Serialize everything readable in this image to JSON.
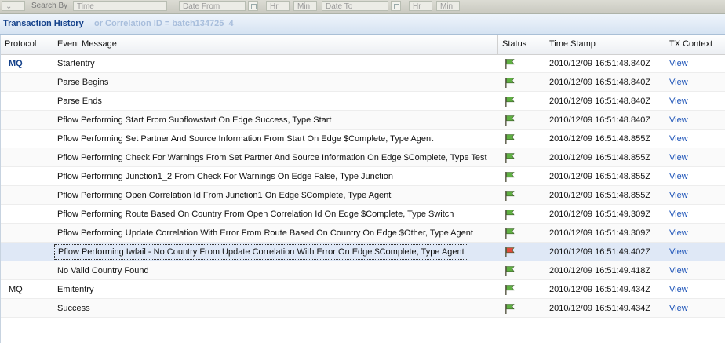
{
  "toolbar": {
    "search_by_label": "Search By",
    "search_by_value": "Time",
    "date_from_placeholder": "Date From",
    "hr1": "Hr",
    "min1": "Min",
    "date_to_placeholder": "Date To",
    "hr2": "Hr",
    "min2": "Min"
  },
  "panel": {
    "title": "Transaction History",
    "subtitle_ghost": "or Correlation ID = batch134725_4"
  },
  "columns": {
    "protocol": "Protocol",
    "message": "Event Message",
    "status": "Status",
    "timestamp": "Time Stamp",
    "context": "TX Context"
  },
  "colors": {
    "flag_ok": "#5fb042",
    "flag_fail": "#e04a3a",
    "selected_row": "#dfe8f6",
    "link": "#1f55b8"
  },
  "rows": [
    {
      "protocol": "MQ",
      "protocol_link": true,
      "message": "Startentry",
      "status": "ok",
      "time": "2010/12/09 16:51:48.840Z",
      "context": "View"
    },
    {
      "protocol": "",
      "message": "Parse Begins",
      "status": "ok",
      "time": "2010/12/09 16:51:48.840Z",
      "context": "View"
    },
    {
      "protocol": "",
      "message": "Parse Ends",
      "status": "ok",
      "time": "2010/12/09 16:51:48.840Z",
      "context": "View"
    },
    {
      "protocol": "",
      "message": "Pflow Performing Start From Subflowstart On Edge Success, Type Start",
      "status": "ok",
      "time": "2010/12/09 16:51:48.840Z",
      "context": "View"
    },
    {
      "protocol": "",
      "message": "Pflow Performing Set Partner And Source Information From Start On Edge $Complete, Type Agent",
      "status": "ok",
      "time": "2010/12/09 16:51:48.855Z",
      "context": "View"
    },
    {
      "protocol": "",
      "message": "Pflow Performing Check For Warnings From Set Partner And Source Information On Edge $Complete, Type Test",
      "status": "ok",
      "time": "2010/12/09 16:51:48.855Z",
      "context": "View"
    },
    {
      "protocol": "",
      "message": "Pflow Performing Junction1_2 From Check For Warnings On Edge False, Type Junction",
      "status": "ok",
      "time": "2010/12/09 16:51:48.855Z",
      "context": "View"
    },
    {
      "protocol": "",
      "message": "Pflow Performing Open Correlation Id From Junction1 On Edge $Complete, Type Agent",
      "status": "ok",
      "time": "2010/12/09 16:51:48.855Z",
      "context": "View"
    },
    {
      "protocol": "",
      "message": "Pflow Performing Route Based On Country From Open Correlation Id On Edge $Complete, Type Switch",
      "status": "ok",
      "time": "2010/12/09 16:51:49.309Z",
      "context": "View"
    },
    {
      "protocol": "",
      "message": "Pflow Performing Update Correlation With Error From Route Based On Country On Edge $Other, Type Agent",
      "status": "ok",
      "time": "2010/12/09 16:51:49.309Z",
      "context": "View"
    },
    {
      "protocol": "",
      "message": "Pflow Performing Iwfail - No Country From Update Correlation With Error On Edge $Complete, Type Agent",
      "status": "fail",
      "time": "2010/12/09 16:51:49.402Z",
      "context": "View",
      "selected": true
    },
    {
      "protocol": "",
      "message": "No Valid Country Found",
      "status": "ok",
      "time": "2010/12/09 16:51:49.418Z",
      "context": "View"
    },
    {
      "protocol": "MQ",
      "protocol_link": false,
      "message": "Emitentry",
      "status": "ok",
      "time": "2010/12/09 16:51:49.434Z",
      "context": "View"
    },
    {
      "protocol": "",
      "message": "Success",
      "status": "ok",
      "time": "2010/12/09 16:51:49.434Z",
      "context": "View"
    }
  ]
}
